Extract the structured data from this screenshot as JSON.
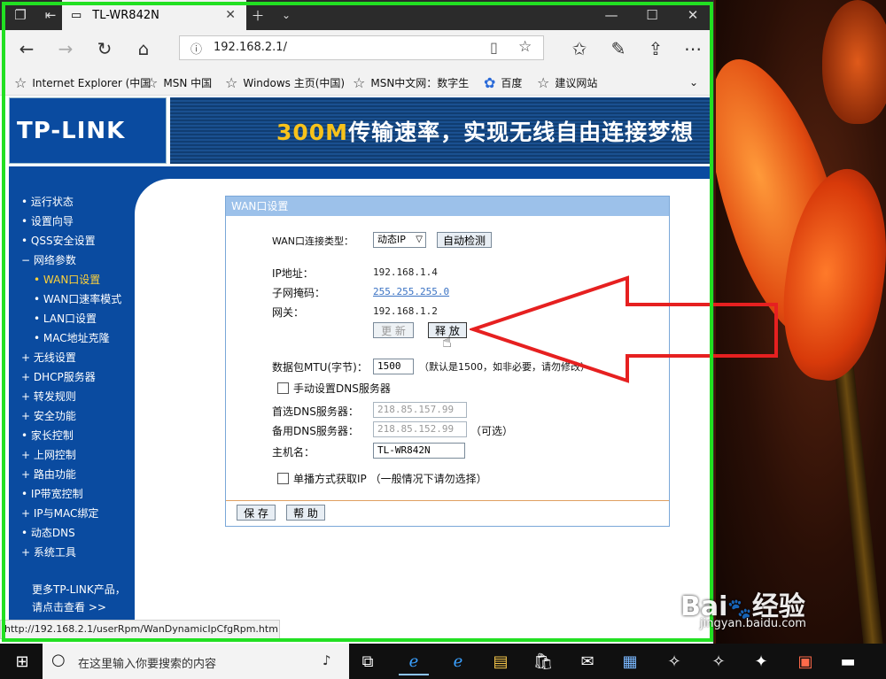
{
  "browser": {
    "tab_title": "TL-WR842N",
    "address": "192.168.2.1/",
    "status_url": "http://192.168.2.1/userRpm/WanDynamicIpCfgRpm.htm"
  },
  "favorites": [
    "Internet Explorer (中国",
    "MSN 中国",
    "Windows 主页(中国)",
    "MSN中文网：数字生",
    "百度",
    "建议网站"
  ],
  "header": {
    "logo": "TP-LINK",
    "banner_highlight": "300M",
    "banner_text": "传输速率，实现无线自由连接梦想"
  },
  "sidebar": {
    "items": [
      {
        "bullet": "•",
        "label": "运行状态"
      },
      {
        "bullet": "•",
        "label": "设置向导"
      },
      {
        "bullet": "•",
        "label": "QSS安全设置"
      },
      {
        "bullet": "−",
        "label": "网络参数"
      },
      {
        "bullet": "•",
        "label": "WAN口设置"
      },
      {
        "bullet": "•",
        "label": "WAN口速率模式"
      },
      {
        "bullet": "•",
        "label": "LAN口设置"
      },
      {
        "bullet": "•",
        "label": "MAC地址克隆"
      },
      {
        "bullet": "+",
        "label": "无线设置"
      },
      {
        "bullet": "+",
        "label": "DHCP服务器"
      },
      {
        "bullet": "+",
        "label": "转发规则"
      },
      {
        "bullet": "+",
        "label": "安全功能"
      },
      {
        "bullet": "•",
        "label": "家长控制"
      },
      {
        "bullet": "+",
        "label": "上网控制"
      },
      {
        "bullet": "+",
        "label": "路由功能"
      },
      {
        "bullet": "•",
        "label": "IP带宽控制"
      },
      {
        "bullet": "+",
        "label": "IP与MAC绑定"
      },
      {
        "bullet": "•",
        "label": "动态DNS"
      },
      {
        "bullet": "+",
        "label": "系统工具"
      }
    ],
    "more_line1": "更多TP-LINK产品，",
    "more_line2": "请点击查看 >>"
  },
  "wan": {
    "title": "WAN口设置",
    "conn_type_label": "WAN口连接类型：",
    "conn_type_value": "动态IP",
    "auto_detect": "自动检测",
    "ip_label": "IP地址：",
    "ip_value": "192.168.1.4",
    "mask_label": "子网掩码：",
    "mask_value": "255.255.255.0",
    "gw_label": "网关：",
    "gw_value": "192.168.1.2",
    "renew": "更 新",
    "release": "释 放",
    "mtu_label": "数据包MTU(字节)：",
    "mtu_value": "1500",
    "mtu_hint": "（默认是1500，如非必要，请勿修改）",
    "manual_dns": "手动设置DNS服务器",
    "dns1_label": "首选DNS服务器：",
    "dns1_value": "218.85.157.99",
    "dns2_label": "备用DNS服务器：",
    "dns2_value": "218.85.152.99",
    "optional": "（可选）",
    "host_label": "主机名：",
    "host_value": "TL-WR842N",
    "unicast": "单播方式获取IP （一般情况下请勿选择）",
    "save": "保 存",
    "help": "帮 助"
  },
  "taskbar": {
    "search_placeholder": "在这里输入你要搜索的内容"
  },
  "watermark": {
    "brand": "Bai",
    "brand2": "经验",
    "url": "jingyan.baidu.com"
  },
  "colors": {
    "accent_blue": "#0a4ba0",
    "frame_green": "#22e022",
    "arrow_red": "#e62020"
  }
}
